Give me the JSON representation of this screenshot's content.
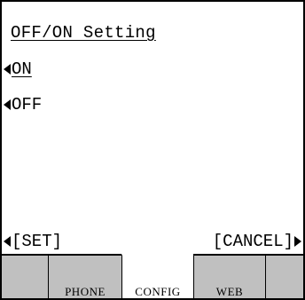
{
  "screen": {
    "title": "OFF/ON Setting",
    "options": [
      {
        "label": "ON",
        "selected": true,
        "icon": "triangle-left-icon"
      },
      {
        "label": "OFF",
        "selected": false,
        "icon": "triangle-left-icon"
      }
    ]
  },
  "softkeys": {
    "left_label": "[SET]",
    "left_icon": "triangle-left-icon",
    "right_label": "[CANCEL]",
    "right_icon": "triangle-right-icon"
  },
  "tabs": [
    {
      "label": ""
    },
    {
      "label": "PHONE"
    },
    {
      "label": "CONFIG",
      "active": true
    },
    {
      "label": "WEB"
    },
    {
      "label": ""
    }
  ],
  "colors": {
    "lcd_background": "#ffffff",
    "text": "#000000",
    "inactive_tab": "#c0c0c0",
    "active_tab": "#ffffff"
  }
}
